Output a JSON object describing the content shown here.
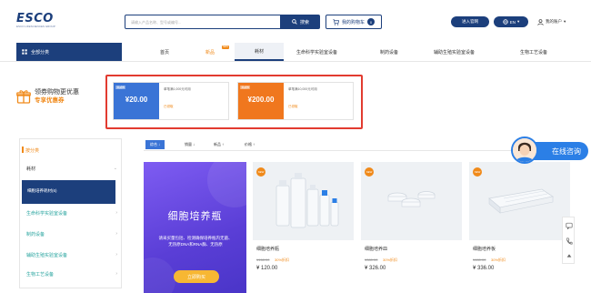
{
  "header": {
    "logo_text": "ESCO",
    "logo_sub": "ESCO LIFESCIENCES GROUP",
    "search_placeholder": "请输入产品名称、型号或编号...",
    "search_label": "搜索",
    "cart_label": "我的购物车",
    "cart_count": "0",
    "site_label": "进入官网",
    "lang_label": "EN",
    "user_label": "我的账户"
  },
  "nav": {
    "all_categories": "全部分类",
    "items": [
      "首页",
      "新品",
      "耗材",
      "生命科学实验室设备",
      "制药设备",
      "辅助生殖实验室设备",
      "生物工艺设备"
    ],
    "new_tag": "NEW"
  },
  "coupons": {
    "title": "领券购物更优惠",
    "subtitle": "专享优惠券",
    "items": [
      {
        "tag": "满减券",
        "amount": "¥20.00",
        "condition": "单笔满1,000元可用",
        "action": "已领取"
      },
      {
        "tag": "满减券",
        "amount": "¥200.00",
        "condition": "单笔满10,000元可用",
        "action": "已领取"
      }
    ]
  },
  "sidebar": {
    "title": "按分类",
    "head": "耗材",
    "selected": "细胞培养耗材(6)",
    "items": [
      "生命科学实验室设备",
      "制药设备",
      "辅助生殖实验室设备",
      "生物工艺设备"
    ]
  },
  "sort": {
    "items": [
      "综合 ↓",
      "销量 ↓",
      "新品 ↑",
      "价格 ↑"
    ]
  },
  "promo": {
    "title": "细胞培养瓶",
    "desc": "请采买量包括、检测确保培养瓶内无菌、无热原DNA和RNA酶、无热原",
    "button": "立即购买"
  },
  "products": [
    {
      "badge": "NEW",
      "name": "细胞培养瓶",
      "orig": "¥168.00",
      "disc": "30%折扣",
      "price": "¥ 120.00"
    },
    {
      "badge": "NEW",
      "name": "细胞培养皿",
      "orig": "¥380.00",
      "disc": "30%折扣",
      "price": "¥ 326.00"
    },
    {
      "badge": "NEW",
      "name": "细胞培养板",
      "orig": "¥480.00",
      "disc": "30%折扣",
      "price": "¥ 336.00"
    }
  ],
  "chat": {
    "label": "在线咨询"
  }
}
